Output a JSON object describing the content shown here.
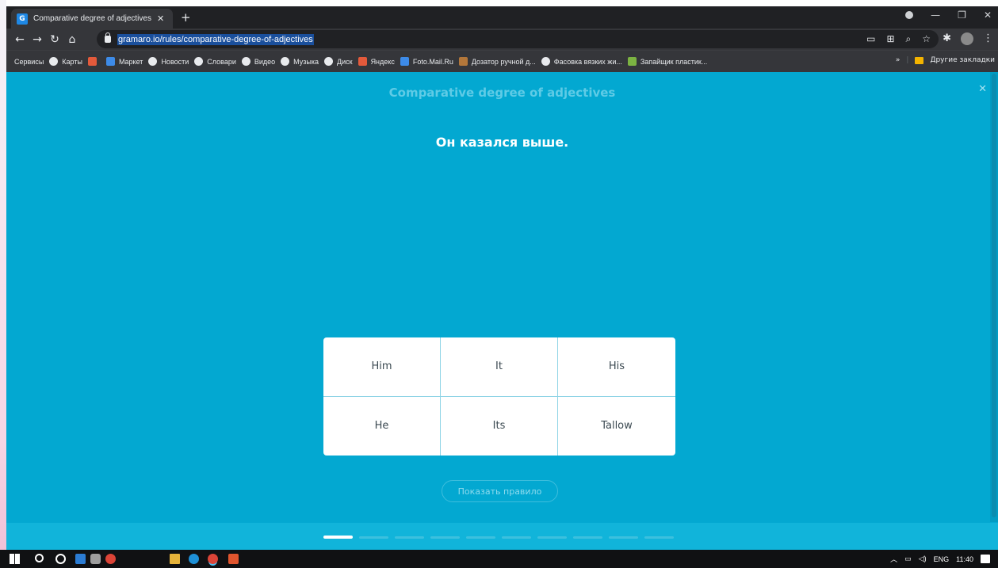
{
  "browser": {
    "tab_title": "Comparative degree of adjectives",
    "favicon_letter": "G",
    "url": "gramaro.io/rules/comparative-degree-of-adjectives"
  },
  "bookmarks": {
    "items": [
      "Сервисы",
      "Карты",
      "",
      "Маркет",
      "Новости",
      "Словари",
      "Видео",
      "Музыка",
      "Диск",
      "Яндекс",
      "Foto.Mail.Ru",
      "Дозатор ручной д...",
      "Фасовка вязких жи...",
      "Запайщик пластик..."
    ],
    "overflow": "»",
    "other": "Другие закладки"
  },
  "lesson": {
    "title": "Comparative degree of adjectives",
    "prompt": "Он казался выше.",
    "options": [
      "Him",
      "It",
      "His",
      "He",
      "Its",
      "Tallow"
    ],
    "rule_button": "Показать правило",
    "progress": {
      "current": 1,
      "total": 10
    }
  },
  "taskbar": {
    "language": "ENG",
    "time": "11:40"
  },
  "colors": {
    "page_bg": "#03a8d1",
    "progress_band": "#11b4da",
    "card_bg": "#ffffff",
    "browser_dark": "#35363a"
  }
}
